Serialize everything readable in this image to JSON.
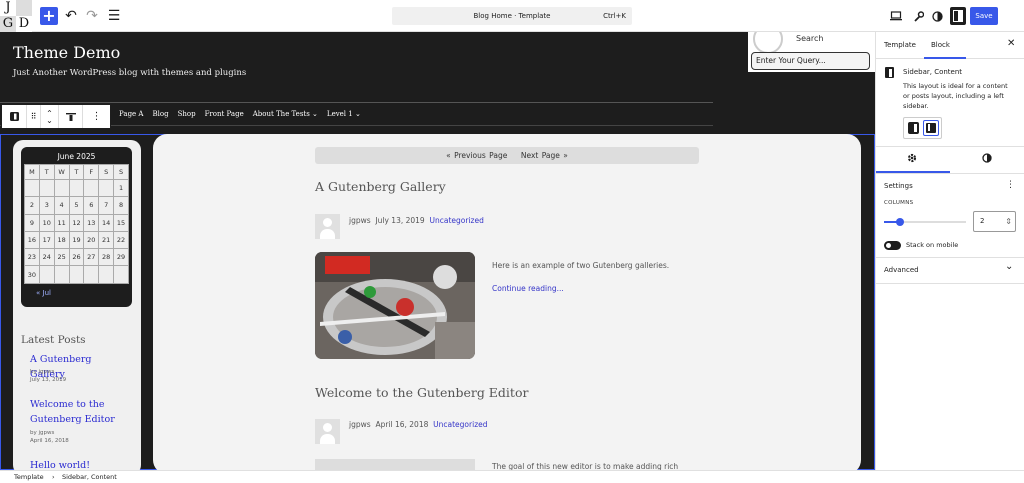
{
  "logo": {
    "letters": [
      "J",
      "",
      "G",
      "D"
    ]
  },
  "topbar": {
    "add_label": "+",
    "undo_icon": "↶",
    "redo_icon": "↷",
    "list_icon": "☰",
    "command": {
      "title": "Blog Home · Template",
      "shortcut": "Ctrl+K"
    },
    "save_label": "Save",
    "accent": "#3858e9"
  },
  "site": {
    "title": "Theme Demo",
    "tagline": "Just Another WordPress blog with themes and plugins"
  },
  "nav": {
    "items": [
      "Page A",
      "Blog",
      "Shop",
      "Front Page",
      "About The Tests ⌄",
      "Level 1 ⌄"
    ]
  },
  "search": {
    "label": "Search",
    "placeholder": "Enter Your Query..."
  },
  "calendar": {
    "caption": "June 2025",
    "days": [
      "M",
      "T",
      "W",
      "T",
      "F",
      "S",
      "S"
    ],
    "weeks": [
      [
        "",
        "",
        "",
        "",
        "",
        "",
        "1"
      ],
      [
        "2",
        "3",
        "4",
        "5",
        "6",
        "7",
        "8"
      ],
      [
        "9",
        "10",
        "11",
        "12",
        "13",
        "14",
        "15"
      ],
      [
        "16",
        "17",
        "18",
        "19",
        "20",
        "21",
        "22"
      ],
      [
        "23",
        "24",
        "25",
        "26",
        "27",
        "28",
        "29"
      ],
      [
        "30",
        "",
        "",
        "",
        "",
        "",
        ""
      ]
    ],
    "prev": "« Jul"
  },
  "latest_posts": {
    "heading": "Latest Posts",
    "items": [
      {
        "title": "A Gutenberg Gallery",
        "by": "by jgpws",
        "date": "July 13, 2019"
      },
      {
        "title": "Welcome to the Gutenberg Editor",
        "by": "by jgpws",
        "date": "April 16, 2018"
      },
      {
        "title": "Hello world!"
      }
    ]
  },
  "pager": {
    "prev": "«  Previous Page",
    "next": "Next Page  »"
  },
  "posts": [
    {
      "title": "A Gutenberg Gallery",
      "author": "jgpws",
      "date": "July 13, 2019",
      "category": "Uncategorized",
      "excerpt": "Here is an example of two Gutenberg galleries.",
      "more": "Continue reading..."
    },
    {
      "title": "Welcome to the Gutenberg Editor",
      "author": "jgpws",
      "date": "April 16, 2018",
      "category": "Uncategorized",
      "excerpt": "The goal of this new editor is to make adding rich"
    }
  ],
  "panel": {
    "tabs": [
      "Template",
      "Block"
    ],
    "close_icon": "✕",
    "block_title": "Sidebar, Content",
    "block_desc": "This layout is ideal for a content or posts layout, including a left sidebar.",
    "settings_heading": "Settings",
    "columns_label": "COLUMNS",
    "columns_value": "2",
    "columns_fraction": 0.2,
    "stack_label": "Stack on mobile",
    "advanced_label": "Advanced",
    "more_icon": "⋮",
    "chevron": "⌄"
  },
  "footer": {
    "crumb1": "Template",
    "sep": "›",
    "crumb2": "Sidebar, Content"
  }
}
